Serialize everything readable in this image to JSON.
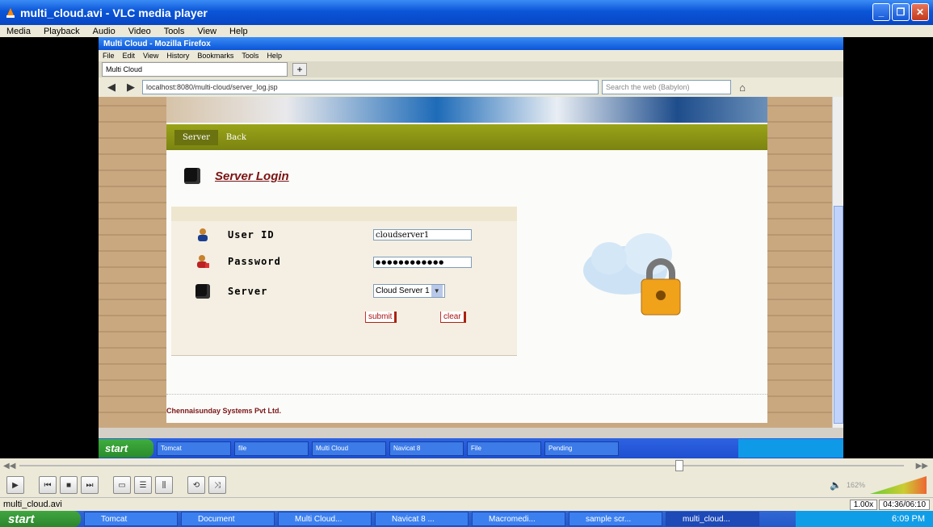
{
  "vlc": {
    "title": "multi_cloud.avi - VLC media player",
    "menu": [
      "Media",
      "Playback",
      "Audio",
      "Video",
      "Tools",
      "View",
      "Help"
    ],
    "file": "multi_cloud.avi",
    "speed": "1.00x",
    "time": "04:36/06:10",
    "volume": "162%",
    "seek_fraction": 0.746
  },
  "firefox": {
    "title": "Multi Cloud - Mozilla Firefox",
    "menu": [
      "File",
      "Edit",
      "View",
      "History",
      "Bookmarks",
      "Tools",
      "Help"
    ],
    "tab": "Multi Cloud",
    "url": "localhost:8080/multi-cloud/server_log.jsp",
    "search_placeholder": "Search the web (Babylon)"
  },
  "page": {
    "nav": [
      "Server",
      "Back"
    ],
    "login_title": "Server Login",
    "labels": {
      "user": "User ID",
      "password": "Password",
      "server": "Server"
    },
    "user_value": "cloudserver1",
    "password_value": "●●●●●●●●●●●●",
    "server_value": "Cloud Server 1",
    "submit": "submit",
    "clear": "clear",
    "copyright": "Chennaisunday Systems Pvt Ltd."
  },
  "inner_taskbar": {
    "start": "start",
    "items": [
      "Tomcat",
      "file",
      "Multi Cloud",
      "Navicat 8",
      "File",
      "Pending"
    ]
  },
  "taskbar": {
    "start": "start",
    "items": [
      "Tomcat",
      "Document",
      "Multi Cloud...",
      "Navicat 8 ...",
      "Macromedi...",
      "sample scr...",
      "multi_cloud..."
    ],
    "clock": "6:09 PM"
  }
}
